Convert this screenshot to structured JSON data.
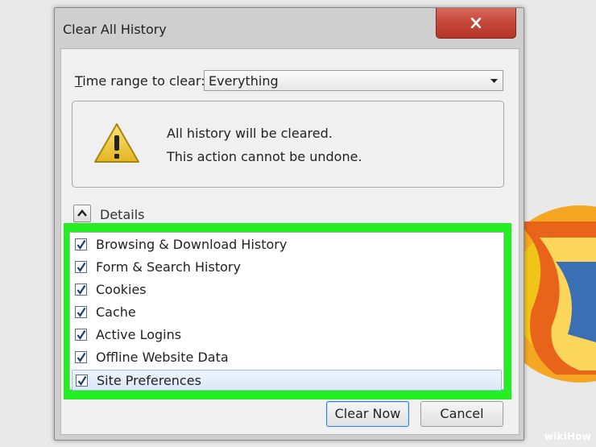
{
  "window": {
    "title": "Clear All History",
    "close_icon": "close-icon"
  },
  "time_range": {
    "label": "Time range to clear:",
    "label_accelerator": "T",
    "label_rest": "ime range to clear:",
    "selected": "Everything",
    "dropdown_icon": "chevron-down-icon"
  },
  "warning": {
    "icon": "warning-icon",
    "line1": "All history will be cleared.",
    "line2": "This action cannot be undone."
  },
  "details": {
    "label": "Details",
    "expanded": true,
    "toggle_icon": "chevron-up-icon"
  },
  "items": [
    {
      "label": "Browsing & Download History",
      "checked": true,
      "selected": false
    },
    {
      "label": "Form & Search History",
      "checked": true,
      "selected": false
    },
    {
      "label": "Cookies",
      "checked": true,
      "selected": false
    },
    {
      "label": "Cache",
      "checked": true,
      "selected": false
    },
    {
      "label": "Active Logins",
      "checked": true,
      "selected": false
    },
    {
      "label": "Offline Website Data",
      "checked": true,
      "selected": false
    },
    {
      "label": "Site Preferences",
      "checked": true,
      "selected": true
    }
  ],
  "buttons": {
    "clear_now": "Clear Now",
    "cancel": "Cancel"
  },
  "colors": {
    "highlight": "#22ee22",
    "close_button": "#c4473a",
    "selected_row": "#dbe8f8"
  },
  "watermark": {
    "prefix": "wiki",
    "suffix": "How"
  }
}
